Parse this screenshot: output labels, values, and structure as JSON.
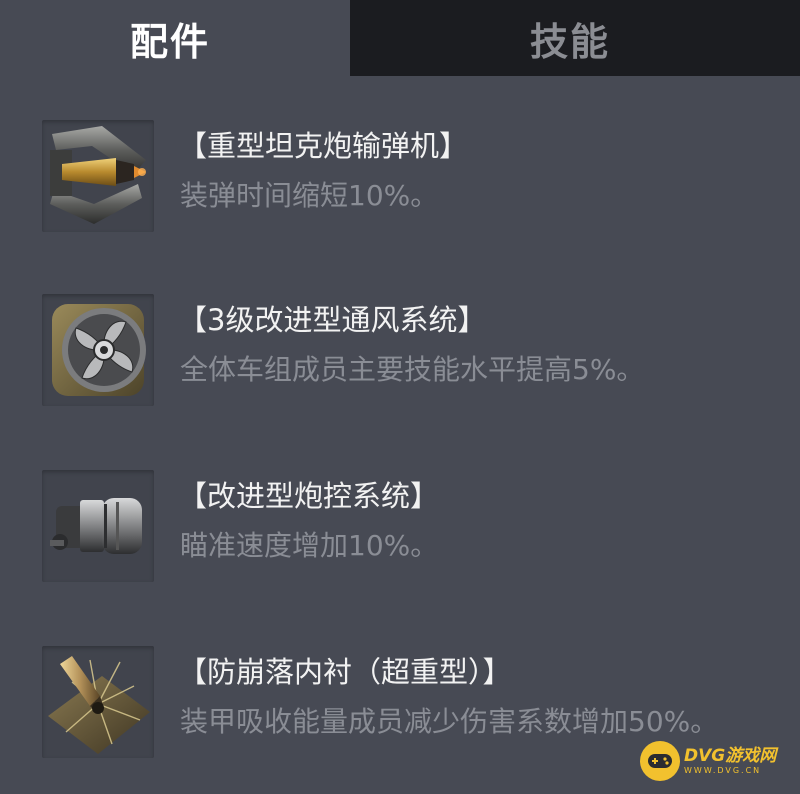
{
  "tabs": [
    {
      "label": "配件",
      "active": true
    },
    {
      "label": "技能",
      "active": false
    }
  ],
  "items": [
    {
      "title": "【重型坦克炮输弹机】",
      "description": "装弹时间缩短10%。",
      "icon": "rammer-icon"
    },
    {
      "title": "【3级改进型通风系统】",
      "description": "全体车组成员主要技能水平提高5%。",
      "icon": "ventilation-fan-icon"
    },
    {
      "title": "【改进型炮控系统】",
      "description": "瞄准速度增加10%。",
      "icon": "gun-control-icon"
    },
    {
      "title": "【防崩落内衬（超重型）】",
      "description": "装甲吸收能量成员减少伤害系数增加50%。",
      "icon": "spall-liner-icon"
    }
  ],
  "watermark": {
    "main": "DVG游戏网",
    "sub": "WWW.DVG.CN"
  },
  "colors": {
    "background": "#474a54",
    "inactive_tab": "#1b1c20",
    "title_text": "#f2f2f2",
    "desc_text": "#8a8d95",
    "watermark": "#f2c12e"
  }
}
